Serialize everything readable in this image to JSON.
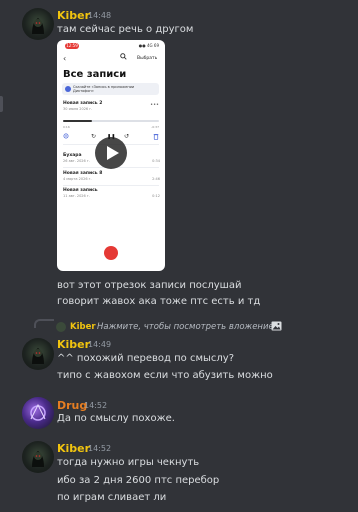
{
  "messages": [
    {
      "author": "Kiber",
      "time": "14:48",
      "lines": [
        "там сейчас речь о другом",
        "вот этот отрезок записи послушай",
        "говорит жавох ака тоже птс есть и тд"
      ]
    },
    {
      "reply": {
        "author": "Kiber",
        "text": "Нажмите, чтобы посмотреть вложение"
      },
      "author": "Kiber",
      "time": "14:49",
      "lines": [
        "^^ похожий перевод по смыслу?",
        "типо с жавохом если что абузить можно"
      ]
    },
    {
      "author": "Drug",
      "time": "14:52",
      "lines": [
        "Да по смыслу похоже."
      ]
    },
    {
      "author": "Kiber",
      "time": "14:52",
      "lines": [
        "тогда нужно игры чекнуть",
        "ибо за 2 дня 2600 птс перебор",
        "по играм сливает ли"
      ]
    }
  ],
  "attachment": {
    "status_time": "12:59",
    "status_icons": "●● 4G 69",
    "back": "‹",
    "choose_label": "Выбрать",
    "title": "Все записи",
    "banner_text": "Скачайте «Запись в приложении Диктофон»",
    "recordings": [
      {
        "title": "Новая запись 2",
        "date": "30 июля 2026 г.",
        "duration": ""
      },
      {
        "title": "Бухара",
        "date": "26 авг. 2026 г.",
        "duration": "0:34"
      },
      {
        "title": "Новая запись 8",
        "date": "4 марта 2026 г.",
        "duration": "2:46"
      },
      {
        "title": "Новая запись",
        "date": "11 авг. 2026 г.",
        "duration": "0:12"
      }
    ],
    "progress": 0.3,
    "time_elapsed": "0:16",
    "time_remaining": "-0:37",
    "controls": [
      "↻",
      "❚❚",
      "↺"
    ],
    "dots": "•••"
  },
  "colors": {
    "background": "#313338",
    "kiber": "#f1c40f",
    "drug": "#e67e22",
    "text": "#dbdee1",
    "timestamp": "#949ba4"
  }
}
